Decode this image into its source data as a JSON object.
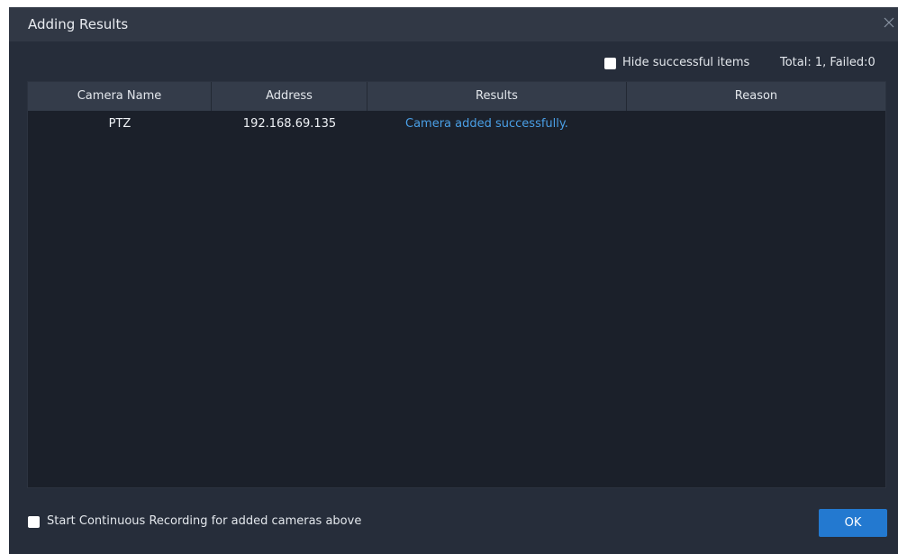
{
  "dialog": {
    "title": "Adding Results",
    "close_icon": "close-icon"
  },
  "toolbar": {
    "hide_successful_label": "Hide successful items",
    "hide_successful_checked": false,
    "totals": "Total: 1, Failed:0"
  },
  "table": {
    "columns": [
      "Camera Name",
      "Address",
      "Results",
      "Reason"
    ],
    "rows": [
      {
        "camera_name": "PTZ",
        "address": "192.168.69.135",
        "result": "Camera added successfully.",
        "reason": ""
      }
    ]
  },
  "footer": {
    "start_recording_label": "Start Continuous Recording for added cameras above",
    "start_recording_checked": false,
    "ok_label": "OK"
  },
  "colors": {
    "dialog_bg": "#262d3a",
    "titlebar_bg": "#313845",
    "table_bg": "#1b202a",
    "header_bg": "#343c4a",
    "success_text": "#4a9fe6",
    "primary_button": "#2379d0"
  }
}
